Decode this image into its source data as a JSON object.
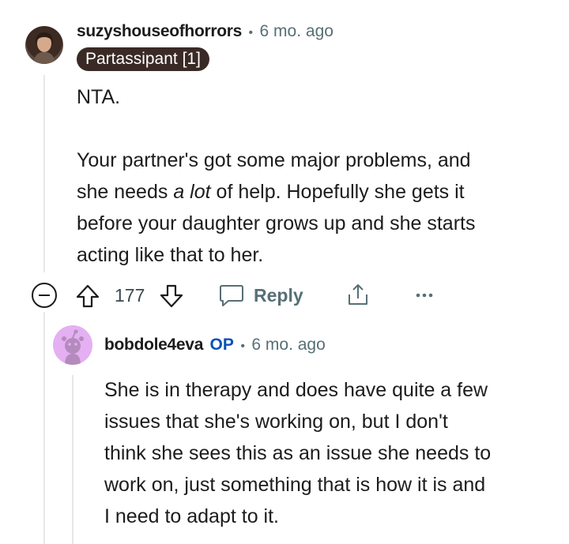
{
  "comment": {
    "username": "suzyshouseofhorrors",
    "separator": "•",
    "time": "6 mo. ago",
    "flair": "Partassipant [1]",
    "body": {
      "line1": "NTA.",
      "para2_line1": "Your partner's got some major problems, and",
      "para2_line2_a": "she needs ",
      "para2_line2_em": "a lot",
      "para2_line2_b": " of help. Hopefully she gets it",
      "para2_line3": "before your daughter grows up and she starts",
      "para2_line4": "acting like that to her."
    },
    "actions": {
      "collapse_icon": "collapse-minus-icon",
      "upvote_icon": "upvote-arrow-icon",
      "score": "177",
      "downvote_icon": "downvote-arrow-icon",
      "reply_icon": "speech-bubble-icon",
      "reply_label": "Reply",
      "share_icon": "share-icon",
      "more_icon": "ellipsis-icon"
    }
  },
  "reply": {
    "username": "bobdole4eva",
    "op_badge": "OP",
    "separator": "•",
    "time": "6 mo. ago",
    "avatar_icon": "snoo-avatar-icon",
    "avatar_bg": "#e4b0f2",
    "body": {
      "line1": "She is in therapy and does have quite a few",
      "line2": "issues that she's working on, but I don't",
      "line3": "think she sees this as an issue she needs to",
      "line4": "work on, just something that is how it is and",
      "line5": "I need to adapt to it."
    }
  },
  "colors": {
    "flair_bg": "#3a2a25",
    "op_blue": "#0a52b5",
    "meta_gray": "#576f76",
    "thread_line": "#e5e7e9"
  }
}
